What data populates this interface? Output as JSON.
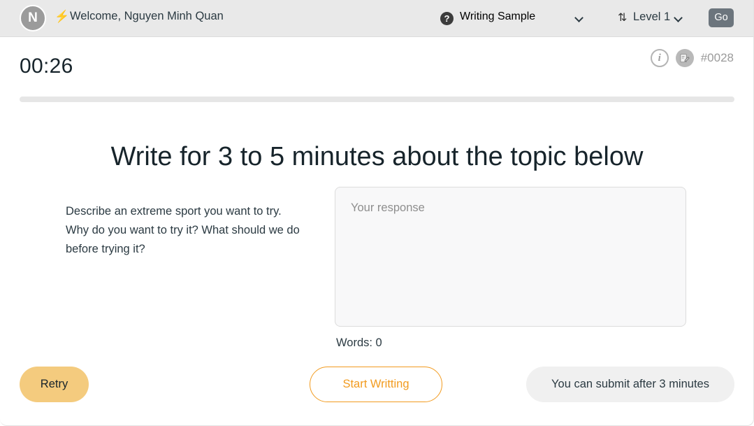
{
  "header": {
    "avatar_initial": "N",
    "bolt_icon": "bolt-icon",
    "welcome_text": "Welcome, Nguyen Minh Quan",
    "help_icon": "question-mark-icon",
    "activity_select": {
      "value": "Writing Sample",
      "chevron": "chevron-down-icon"
    },
    "level_select": {
      "sort_icon": "sort-updown-icon",
      "value": "Level 1",
      "chevron": "chevron-down-icon"
    },
    "go_label": "Go"
  },
  "status": {
    "timer": "00:26",
    "info_icon": "info-icon",
    "info_glyph": "i",
    "note_icon": "note-edit-icon",
    "ticket_id": "#0028",
    "progress_percent": 0
  },
  "main": {
    "headline": "Write for 3 to 5 minutes about the topic below",
    "prompt": "Describe an extreme sport you want to try. Why do you want to try it? What should we do before trying it?",
    "response": {
      "value": "",
      "placeholder": "Your response"
    },
    "word_count_label": "Words: 0"
  },
  "footer": {
    "retry_label": "Retry",
    "start_label": "Start Writting",
    "submit_label": "You can submit after 3 minutes"
  },
  "colors": {
    "accent_orange": "#f29b1f",
    "retry_amber": "#f4cb7e",
    "header_bg": "#e9e9e9",
    "go_gray": "#6c757d",
    "muted_gray": "#9b9b9b"
  }
}
